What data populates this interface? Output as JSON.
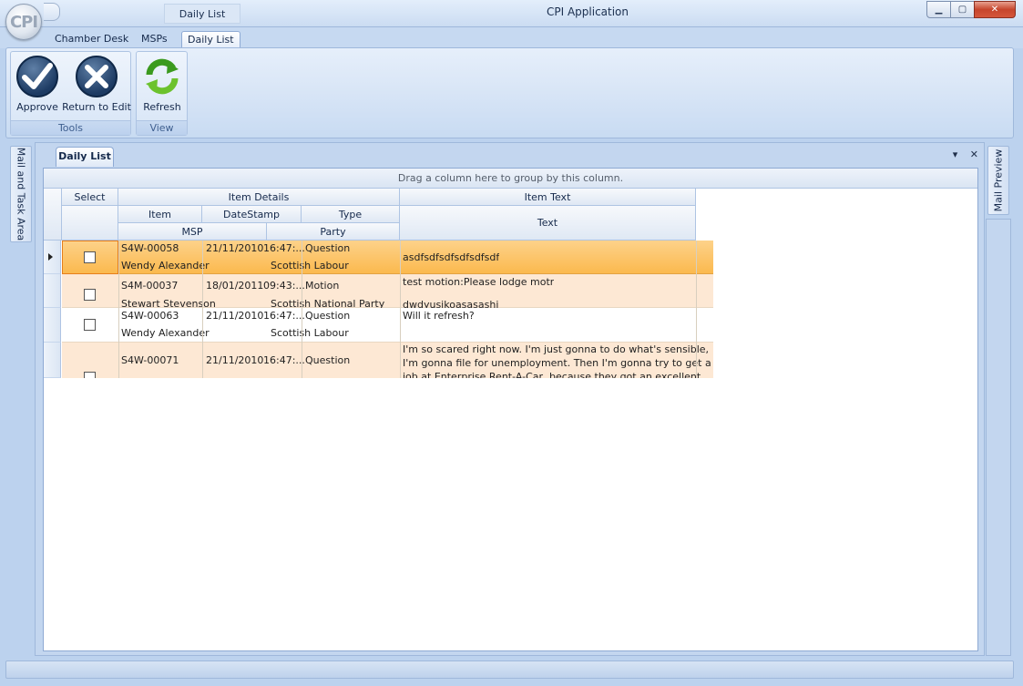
{
  "window": {
    "document_title": "Daily List",
    "app_title": "CPI Application",
    "orb_label": "CPI"
  },
  "ribbon": {
    "tabs": [
      "Chamber Desk",
      "MSPs",
      "Daily List"
    ],
    "active_tab": "Daily List",
    "groups": [
      {
        "label": "Tools",
        "buttons": [
          {
            "label": "Approve",
            "icon": "approve-check-icon"
          },
          {
            "label": "Return to Edit",
            "icon": "return-x-icon"
          }
        ]
      },
      {
        "label": "View",
        "buttons": [
          {
            "label": "Refresh",
            "icon": "refresh-icon"
          }
        ]
      }
    ]
  },
  "side_panes": {
    "left": "Mail and Task Area",
    "right": "Mail Preview"
  },
  "document": {
    "tab": "Daily List"
  },
  "grid": {
    "group_panel_text": "Drag a column here to group by this column.",
    "bands": {
      "select": "Select",
      "item_details": "Item Details",
      "item_text": "Item Text"
    },
    "columns": {
      "item": "Item",
      "datestamp": "DateStamp",
      "type": "Type",
      "msp": "MSP",
      "party": "Party",
      "text": "Text"
    },
    "rows": [
      {
        "item": "S4W-00058",
        "date": "21/11/2010",
        "time": "16:47:...",
        "type": "Question",
        "msp": "Wendy Alexander",
        "party": "Scottish Labour",
        "text": "asdfsdfsdfsdfsdfsdf",
        "text2": "",
        "selected": true
      },
      {
        "item": "S4M-00037",
        "date": "18/01/2011",
        "time": "09:43:...",
        "type": "Motion",
        "msp": "Stewart Stevenson",
        "party": "Scottish National Party",
        "text": "test motion:Please lodge motr",
        "text2": "dwdyusjkoasasashj",
        "selected": false
      },
      {
        "item": "S4W-00063",
        "date": "21/11/2010",
        "time": "16:47:...",
        "type": "Question",
        "msp": "Wendy Alexander",
        "party": "Scottish Labour",
        "text": "Will it refresh?",
        "text2": "",
        "selected": false
      },
      {
        "item": "S4W-00071",
        "date": "21/11/2010",
        "time": "16:47:...",
        "type": "Question",
        "msp": "",
        "party": "",
        "text": " I'm so scared right now. I'm just gonna to do what's sensible,",
        "text2": "I'm gonna file for unemployment. Then I'm gonna try to get a",
        "text3": "job at Enterprise Rent-A-Car, because they got an excellent",
        "selected": false
      }
    ]
  },
  "colors": {
    "active_row": "#fcc46a",
    "alt_row": "#fde8d4",
    "accent": "#8eaad4"
  }
}
